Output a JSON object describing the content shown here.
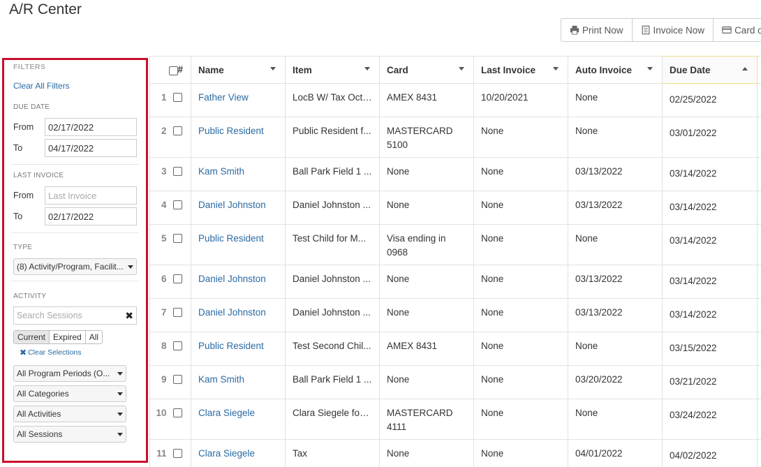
{
  "page": {
    "title": "A/R Center"
  },
  "toolbar": {
    "print_now": "Print Now",
    "invoice_now": "Invoice Now",
    "card": "Card o"
  },
  "filters": {
    "heading": "FILTERS",
    "clear_all": "Clear All Filters",
    "due_date": {
      "label": "DUE DATE",
      "from_label": "From",
      "from_value": "02/17/2022",
      "to_label": "To",
      "to_value": "04/17/2022"
    },
    "last_invoice": {
      "label": "LAST INVOICE",
      "from_label": "From",
      "from_placeholder": "Last Invoice",
      "to_label": "To",
      "to_value": "02/17/2022"
    },
    "type": {
      "label": "TYPE",
      "value": "(8) Activity/Program, Facilit..."
    },
    "activity": {
      "label": "ACTIVITY",
      "search_placeholder": "Search Sessions",
      "clear_x": "✖",
      "segments": [
        "Current",
        "Expired",
        "All"
      ],
      "active_segment": "Current",
      "clear_selections": "Clear Selections",
      "clear_selections_icon": "✖",
      "program_periods": "All Program Periods (O...",
      "categories": "All Categories",
      "activities": "All Activities",
      "sessions": "All Sessions"
    }
  },
  "table": {
    "headers": {
      "num": "#",
      "name": "Name",
      "item": "Item",
      "card": "Card",
      "last_invoice": "Last Invoice",
      "auto_invoice": "Auto Invoice",
      "due_date": "Due Date"
    },
    "rows": [
      {
        "num": "1",
        "name": "Father View",
        "item": "LocB W/ Tax Oct ...",
        "card": "AMEX 8431",
        "last_invoice": "10/20/2021",
        "auto_invoice": "None",
        "due_date": "02/25/2022"
      },
      {
        "num": "2",
        "name": "Public Resident",
        "item": "Public Resident f...",
        "card": "MASTERCARD 5100",
        "last_invoice": "None",
        "auto_invoice": "None",
        "due_date": "03/01/2022"
      },
      {
        "num": "3",
        "name": "Kam Smith",
        "item": "Ball Park Field 1 ...",
        "card": "None",
        "last_invoice": "None",
        "auto_invoice": "03/13/2022",
        "due_date": "03/14/2022"
      },
      {
        "num": "4",
        "name": "Daniel Johnston",
        "item": "Daniel Johnston ...",
        "card": "None",
        "last_invoice": "None",
        "auto_invoice": "03/13/2022",
        "due_date": "03/14/2022"
      },
      {
        "num": "5",
        "name": "Public Resident",
        "item": "Test Child for M...",
        "card": "Visa ending in 0968",
        "last_invoice": "None",
        "auto_invoice": "None",
        "due_date": "03/14/2022"
      },
      {
        "num": "6",
        "name": "Daniel Johnston",
        "item": "Daniel Johnston ...",
        "card": "None",
        "last_invoice": "None",
        "auto_invoice": "03/13/2022",
        "due_date": "03/14/2022"
      },
      {
        "num": "7",
        "name": "Daniel Johnston",
        "item": "Daniel Johnston ...",
        "card": "None",
        "last_invoice": "None",
        "auto_invoice": "03/13/2022",
        "due_date": "03/14/2022"
      },
      {
        "num": "8",
        "name": "Public Resident",
        "item": "Test Second Chil...",
        "card": "AMEX 8431",
        "last_invoice": "None",
        "auto_invoice": "None",
        "due_date": "03/15/2022"
      },
      {
        "num": "9",
        "name": "Kam Smith",
        "item": "Ball Park Field 1 ...",
        "card": "None",
        "last_invoice": "None",
        "auto_invoice": "03/20/2022",
        "due_date": "03/21/2022"
      },
      {
        "num": "10",
        "name": "Clara Siegele",
        "item": "Clara Siegele for ...",
        "card": "MASTERCARD 4111",
        "last_invoice": "None",
        "auto_invoice": "None",
        "due_date": "03/24/2022"
      },
      {
        "num": "11",
        "name": "Clara Siegele",
        "item": "Tax",
        "card": "None",
        "last_invoice": "None",
        "auto_invoice": "04/01/2022",
        "due_date": "04/02/2022"
      }
    ]
  }
}
